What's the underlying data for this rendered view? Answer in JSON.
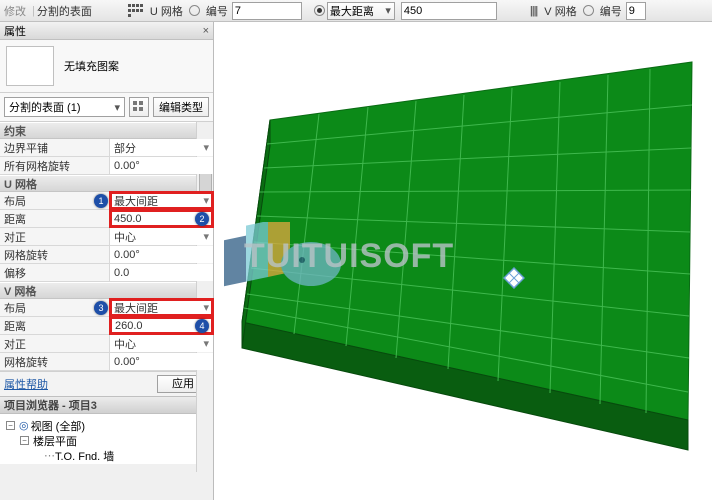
{
  "top_bar": {
    "tab1": "修改",
    "tab2": "分割的表面",
    "u_grid_label": "U 网格",
    "number_label": "编号",
    "u_number_value": "7",
    "max_dist_label": "最大距离",
    "u_dist_value": "450",
    "v_grid_label": "V 网格",
    "v_number_value": "9"
  },
  "panel": {
    "title": "属性",
    "close": "×",
    "no_fill": "无填充图案",
    "selector": "分割的表面 (1)",
    "edit_type": "编辑类型",
    "sections": {
      "constraint": "约束",
      "u_grid": "U 网格",
      "v_grid": "V 网格"
    },
    "rows": {
      "boundary_tile_k": "边界平铺",
      "boundary_tile_v": "部分",
      "all_grid_rot_k": "所有网格旋转",
      "all_grid_rot_v": "0.00°",
      "layout_k": "布局",
      "u_layout_v": "最大间距",
      "distance_k": "距离",
      "u_distance_v": "450.0",
      "justify_k": "对正",
      "justify_v": "中心",
      "grid_rot_k": "网格旋转",
      "grid_rot_v": "0.00°",
      "offset_k": "偏移",
      "offset_v": "0.0",
      "v_layout_v": "最大间距",
      "v_distance_v": "260.0"
    },
    "help_link": "属性帮助",
    "apply": "应用"
  },
  "browser": {
    "title": "项目浏览器 - 项目3",
    "close": "×",
    "views": "视图 (全部)",
    "floor_plans": "楼层平面",
    "item1": "T.O. Fnd. 墙"
  },
  "badges": {
    "b1": "1",
    "b2": "2",
    "b3": "3",
    "b4": "4"
  },
  "watermark": "TUITUISOFT"
}
